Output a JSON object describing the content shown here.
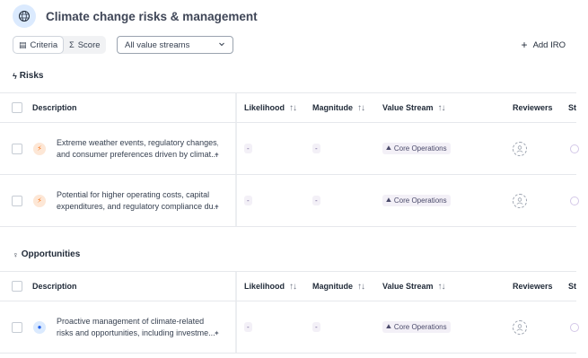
{
  "header": {
    "title": "Climate change risks & management"
  },
  "toolbar": {
    "criteria_label": "Criteria",
    "score_label": "Score",
    "value_stream_selected": "All value streams",
    "add_iro_label": "Add IRO"
  },
  "columns": {
    "description": "Description",
    "likelihood": "Likelihood",
    "magnitude": "Magnitude",
    "value_stream": "Value Stream",
    "reviewers": "Reviewers",
    "status": "St"
  },
  "risks": {
    "title": "Risks",
    "rows": [
      {
        "line1": "Extreme weather events, regulatory changes,",
        "line2": "and consumer preferences driven by climat...",
        "likelihood": "-",
        "magnitude": "-",
        "value_stream": "Core Operations"
      },
      {
        "line1": "Potential for higher operating costs, capital",
        "line2": "expenditures, and regulatory compliance du...",
        "likelihood": "-",
        "magnitude": "-",
        "value_stream": "Core Operations"
      }
    ]
  },
  "opportunities": {
    "title": "Opportunities",
    "rows": [
      {
        "line1": "Proactive management of climate-related",
        "line2": "risks and opportunities, including investme...",
        "likelihood": "-",
        "magnitude": "-",
        "value_stream": "Core Operations"
      }
    ]
  },
  "colors": {
    "risk_accent": "#f97316",
    "opportunity_accent": "#2563eb",
    "badge_bg": "#f3f0f7"
  }
}
